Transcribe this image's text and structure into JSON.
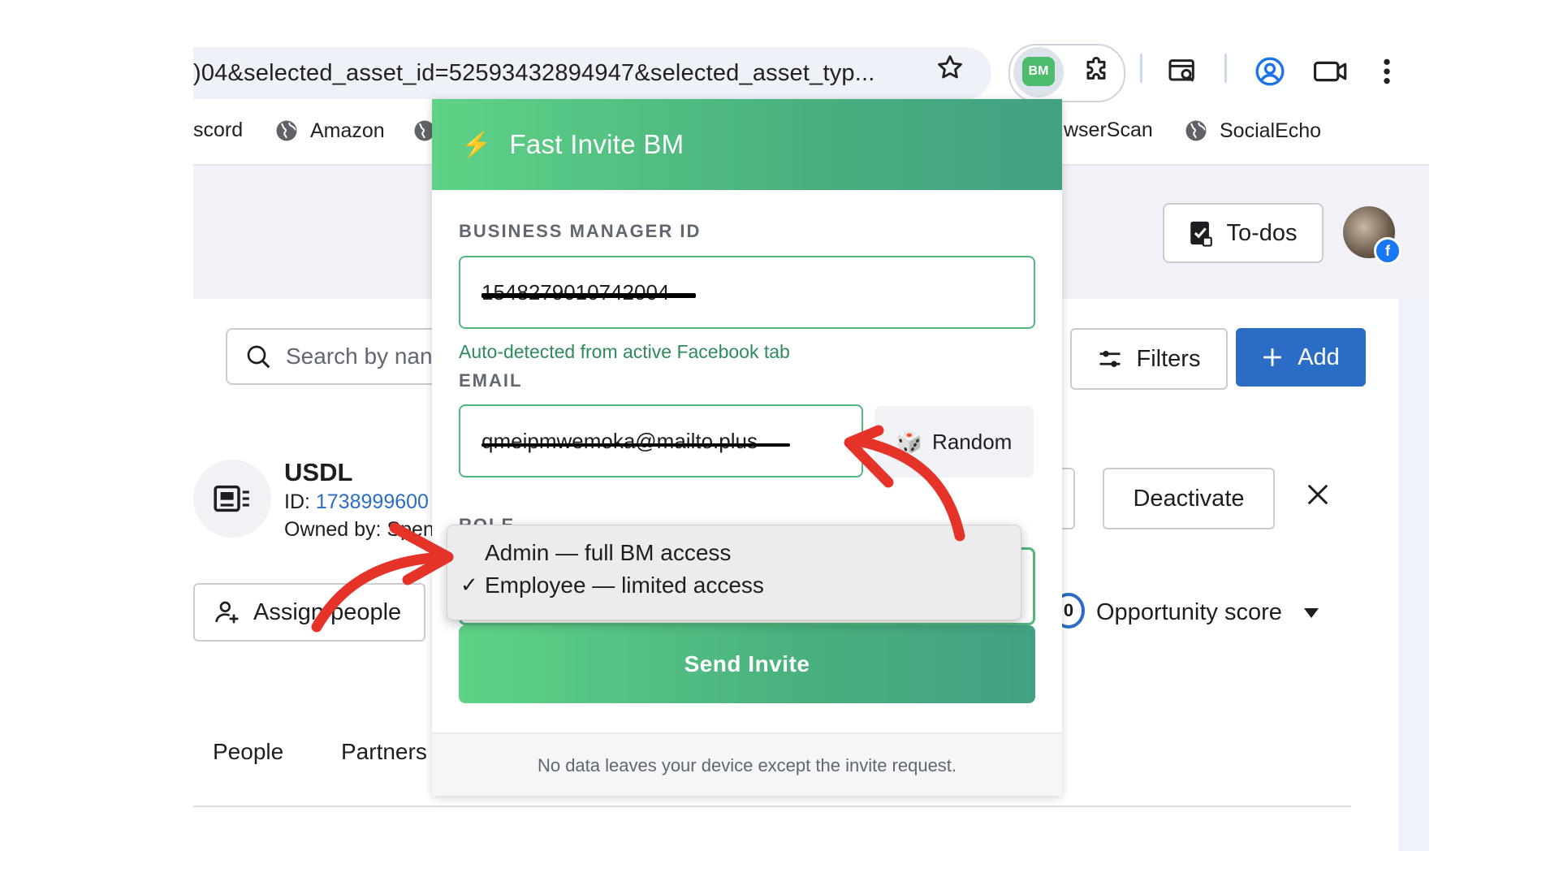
{
  "browser": {
    "url_text": ")04&selected_asset_id=52593432894947&selected_asset_typ...",
    "extension_badge": "BM",
    "bookmarks": [
      {
        "label": "scord"
      },
      {
        "label": "Amazon"
      },
      {
        "label": "wserScan"
      },
      {
        "label": "SocialEcho"
      }
    ]
  },
  "page": {
    "todos_label": "To-dos",
    "search_placeholder": "Search by nan",
    "filters_label": "Filters",
    "add_label": "Add",
    "asset": {
      "name": "USDL",
      "id_prefix": "ID: ",
      "id_value": "1738999600",
      "owner": "Owned by: Spen"
    },
    "deactivate_label": "Deactivate",
    "assign_label": "Assign people",
    "score_value": "0",
    "opportunity_label": "Opportunity score",
    "tabs": [
      {
        "label": "People"
      },
      {
        "label": "Partners"
      }
    ]
  },
  "popup": {
    "title": "Fast Invite BM",
    "bm_id_label": "BUSINESS MANAGER ID",
    "bm_id_value": "1548279010742004",
    "auto_detect_hint": "Auto-detected from active Facebook tab",
    "email_label": "EMAIL",
    "email_value": "qmeipmwemoka@mailto.plus",
    "random_label": "Random",
    "role_label": "ROLE",
    "role_options": [
      {
        "label": "Admin — full BM access",
        "selected": false
      },
      {
        "label": "Employee — limited access",
        "selected": true
      }
    ],
    "check_mark": "✓",
    "send_label": "Send Invite",
    "footer_note": "No data leaves your device except the invite request."
  },
  "colors": {
    "accent_green": "#4cbb6b",
    "primary_blue": "#2b6dc5",
    "annotation_red": "#e5332a"
  }
}
